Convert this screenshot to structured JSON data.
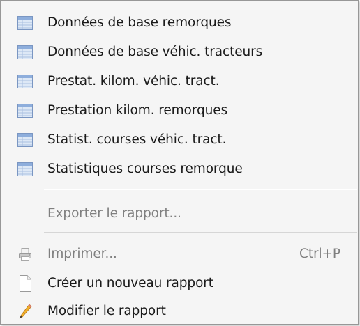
{
  "menu": {
    "items": [
      {
        "label": "Données de base remorques",
        "icon": "table-icon"
      },
      {
        "label": "Données de base véhic. tracteurs",
        "icon": "table-icon"
      },
      {
        "label": "Prestat. kilom. véhic. tract.",
        "icon": "table-icon"
      },
      {
        "label": "Prestation kilom. remorques",
        "icon": "table-icon"
      },
      {
        "label": "Statist. courses véhic. tract.",
        "icon": "table-icon"
      },
      {
        "label": "Statistiques courses remorque",
        "icon": "table-icon"
      }
    ],
    "export_label": "Exporter le rapport...",
    "print_label": "Imprimer...",
    "print_shortcut": "Ctrl+P",
    "print_icon": "printer-icon",
    "new_report_label": "Créer un nouveau rapport",
    "new_report_icon": "blank-document-icon",
    "edit_report_label": "Modifier le rapport",
    "edit_report_icon": "pencil-icon"
  }
}
